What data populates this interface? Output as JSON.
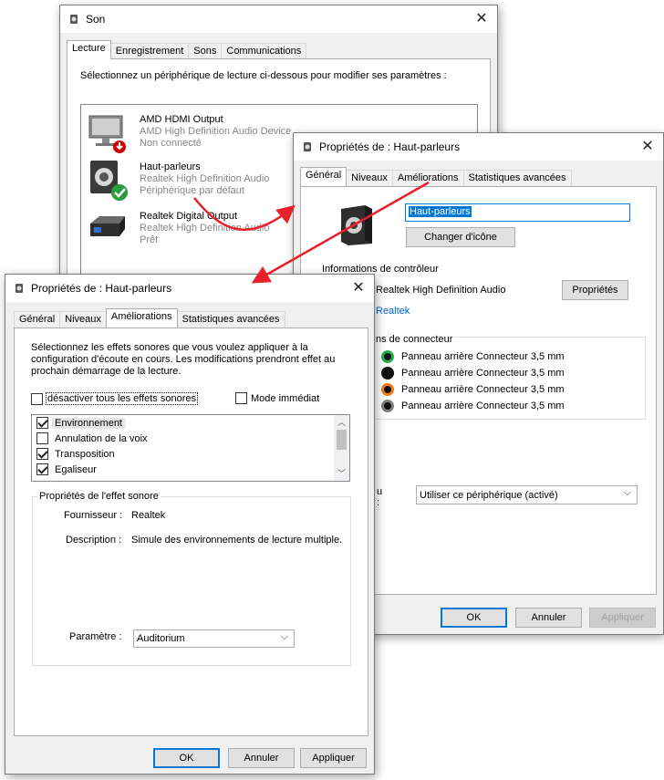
{
  "son": {
    "title": "Son",
    "tabs": [
      "Lecture",
      "Enregistrement",
      "Sons",
      "Communications"
    ],
    "instruction": "Sélectionnez un périphérique de lecture ci-dessous pour modifier ses paramètres :",
    "devices": [
      {
        "name": "AMD HDMI Output",
        "driver": "AMD High Definition Audio Device",
        "status": "Non connecté"
      },
      {
        "name": "Haut-parleurs",
        "driver": "Realtek High Definition Audio",
        "status": "Périphérique par défaut"
      },
      {
        "name": "Realtek Digital Output",
        "driver": "Realtek High Definition Audio",
        "status": "Prêt"
      }
    ]
  },
  "props_general": {
    "title": "Propriétés de : Haut-parleurs",
    "tabs": [
      "Général",
      "Niveaux",
      "Améliorations",
      "Statistiques avancées"
    ],
    "name_value": "Haut-parleurs",
    "change_icon_label": "Changer d'icône",
    "controller_group_label": "Informations de contrôleur",
    "controller_name": "Realtek High Definition Audio",
    "controller_vendor": "Realtek",
    "properties_button": "Propriétés",
    "jack_group_label": "ns de connecteur",
    "jacks": [
      {
        "label": "Panneau arrière Connecteur 3,5 mm",
        "ring": "#22b14c"
      },
      {
        "label": "Panneau arrière Connecteur 3,5 mm",
        "ring": "#111111"
      },
      {
        "label": "Panneau arrière Connecteur 3,5 mm",
        "ring": "#f07d1a"
      },
      {
        "label": "Panneau arrière Connecteur 3,5 mm",
        "ring": "#7f7f7f"
      }
    ],
    "usage_label_line1": "u",
    "usage_label_line2": ":",
    "usage_value": "Utiliser ce périphérique (activé)",
    "ok": "OK",
    "cancel": "Annuler",
    "apply": "Appliquer"
  },
  "props_enh": {
    "title": "Propriétés de : Haut-parleurs",
    "tabs": [
      "Général",
      "Niveaux",
      "Améliorations",
      "Statistiques avancées"
    ],
    "intro": "Sélectionnez les effets sonores que vous voulez appliquer à la configuration d'écoute en cours. Les modifications prendront effet au prochain démarrage de la lecture.",
    "disable_all": "désactiver tous les effets sonores",
    "immediate": "Mode immédiat",
    "effects": [
      {
        "label": "Environnement",
        "checked": true
      },
      {
        "label": "Annulation de la voix",
        "checked": false
      },
      {
        "label": "Transposition",
        "checked": true
      },
      {
        "label": "Egaliseur",
        "checked": true
      }
    ],
    "effect_props_label": "Propriétés de l'effet sonore",
    "provider_label": "Fournisseur :",
    "provider_value": "Realtek",
    "description_label": "Description :",
    "description_value": "Simule des environnements de lecture multiple.",
    "param_label": "Paramètre :",
    "param_value": "Auditorium",
    "ok": "OK",
    "cancel": "Annuler",
    "apply": "Appliquer"
  },
  "colors": {
    "arrow": "#e8202a",
    "focus": "#0078d7",
    "link": "#0066cc"
  }
}
